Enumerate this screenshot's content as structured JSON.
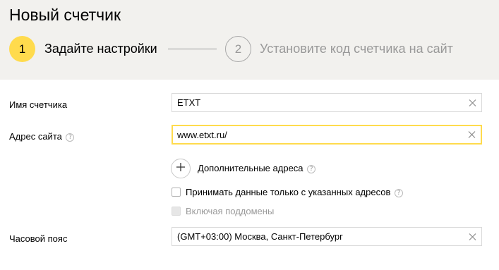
{
  "page": {
    "title": "Новый счетчик"
  },
  "steps": [
    {
      "number": "1",
      "label": "Задайте настройки"
    },
    {
      "number": "2",
      "label": "Установите код счетчика на сайт"
    }
  ],
  "form": {
    "counter_name": {
      "label": "Имя счетчика",
      "value": "ETXT"
    },
    "site_address": {
      "label": "Адрес сайта",
      "value": "www.etxt.ru/"
    },
    "additional_addresses": {
      "label": "Дополнительные адреса"
    },
    "accept_only_specified": {
      "label": "Принимать данные только с указанных адресов",
      "checked": false
    },
    "include_subdomains": {
      "label": "Включая поддомены",
      "checked": false,
      "disabled": true
    },
    "timezone": {
      "label": "Часовой пояс",
      "value": "(GMT+03:00) Москва, Санкт-Петербург"
    }
  },
  "icons": {
    "help": "?",
    "clear": "close-icon",
    "add": "plus-icon"
  },
  "colors": {
    "accent": "#ffdb4d",
    "header_bg": "#f2f1ee",
    "muted": "#999999"
  }
}
